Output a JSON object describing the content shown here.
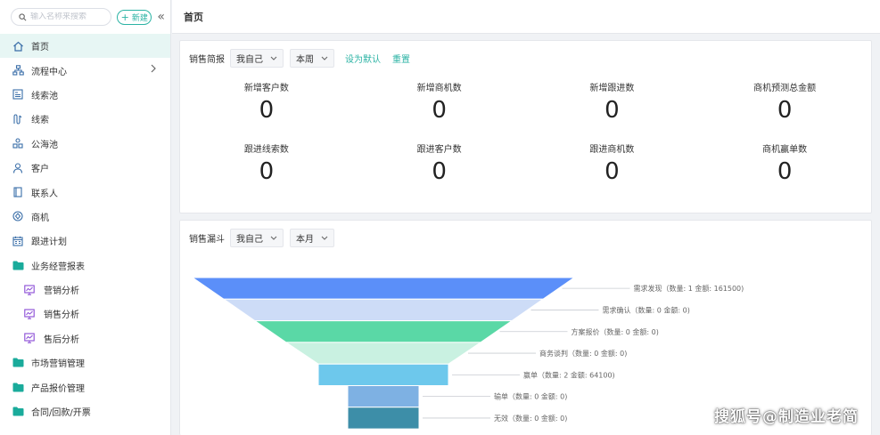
{
  "sidebar": {
    "search_placeholder": "输入名称来搜索",
    "new_label": "新建",
    "collapse_glyph": "«",
    "items": [
      {
        "label": "首页",
        "icon": "home-icon",
        "active": true
      },
      {
        "label": "流程中心",
        "icon": "flow-icon",
        "has_arrow": true
      },
      {
        "label": "线索池",
        "icon": "lead-pool-icon"
      },
      {
        "label": "线索",
        "icon": "lead-icon"
      },
      {
        "label": "公海池",
        "icon": "public-pool-icon"
      },
      {
        "label": "客户",
        "icon": "customer-icon"
      },
      {
        "label": "联系人",
        "icon": "contact-icon"
      },
      {
        "label": "商机",
        "icon": "opportunity-icon"
      },
      {
        "label": "跟进计划",
        "icon": "calendar-icon"
      },
      {
        "label": "业务经营报表",
        "icon": "folder-icon"
      },
      {
        "label": "营销分析",
        "icon": "chart-monitor-icon",
        "sub": true
      },
      {
        "label": "销售分析",
        "icon": "chart-monitor-icon",
        "sub": true
      },
      {
        "label": "售后分析",
        "icon": "chart-monitor-icon",
        "sub": true
      },
      {
        "label": "市场营销管理",
        "icon": "folder-icon"
      },
      {
        "label": "产品报价管理",
        "icon": "folder-icon"
      },
      {
        "label": "合同/回款/开票",
        "icon": "folder-icon"
      }
    ]
  },
  "topbar": {
    "title": "首页"
  },
  "sales_brief": {
    "label": "销售简报",
    "owner_select": "我自己",
    "period_select": "本周",
    "set_default": "设为默认",
    "reset": "重置",
    "stats": [
      {
        "label": "新增客户数",
        "value": "0"
      },
      {
        "label": "新增商机数",
        "value": "0"
      },
      {
        "label": "新增跟进数",
        "value": "0"
      },
      {
        "label": "商机预测总金额",
        "value": "0"
      },
      {
        "label": "跟进线索数",
        "value": "0"
      },
      {
        "label": "跟进客户数",
        "value": "0"
      },
      {
        "label": "跟进商机数",
        "value": "0"
      },
      {
        "label": "商机赢单数",
        "value": "0"
      }
    ]
  },
  "sales_funnel": {
    "label": "销售漏斗",
    "owner_select": "我自己",
    "period_select": "本月"
  },
  "chart_data": {
    "type": "funnel",
    "stages": [
      {
        "name": "需求发现",
        "count": 1,
        "amount": 161500,
        "label": "需求发现（数量: 1 金额: 161500)",
        "color": "#5b8ff9"
      },
      {
        "name": "需求确认",
        "count": 0,
        "amount": 0,
        "label": "需求确认（数量: 0 金额: 0)",
        "color": "#cddcf7"
      },
      {
        "name": "方案报价",
        "count": 0,
        "amount": 0,
        "label": "方案报价（数量: 0 金额: 0)",
        "color": "#5ad8a6"
      },
      {
        "name": "商务谈判",
        "count": 0,
        "amount": 0,
        "label": "商务谈判（数量: 0 金额: 0)",
        "color": "#c9f1e1"
      },
      {
        "name": "赢单",
        "count": 2,
        "amount": 64100,
        "label": "赢单（数量: 2 金额: 64100)",
        "color": "#6dc8ec"
      },
      {
        "name": "输单",
        "count": 0,
        "amount": 0,
        "label": "输单（数量: 0 金额: 0)",
        "color": "#7eb1e3"
      },
      {
        "name": "无效",
        "count": 0,
        "amount": 0,
        "label": "无效（数量: 0 金额: 0)",
        "color": "#3d8ea8"
      }
    ]
  },
  "watermark": "搜狐号@制造业老简"
}
